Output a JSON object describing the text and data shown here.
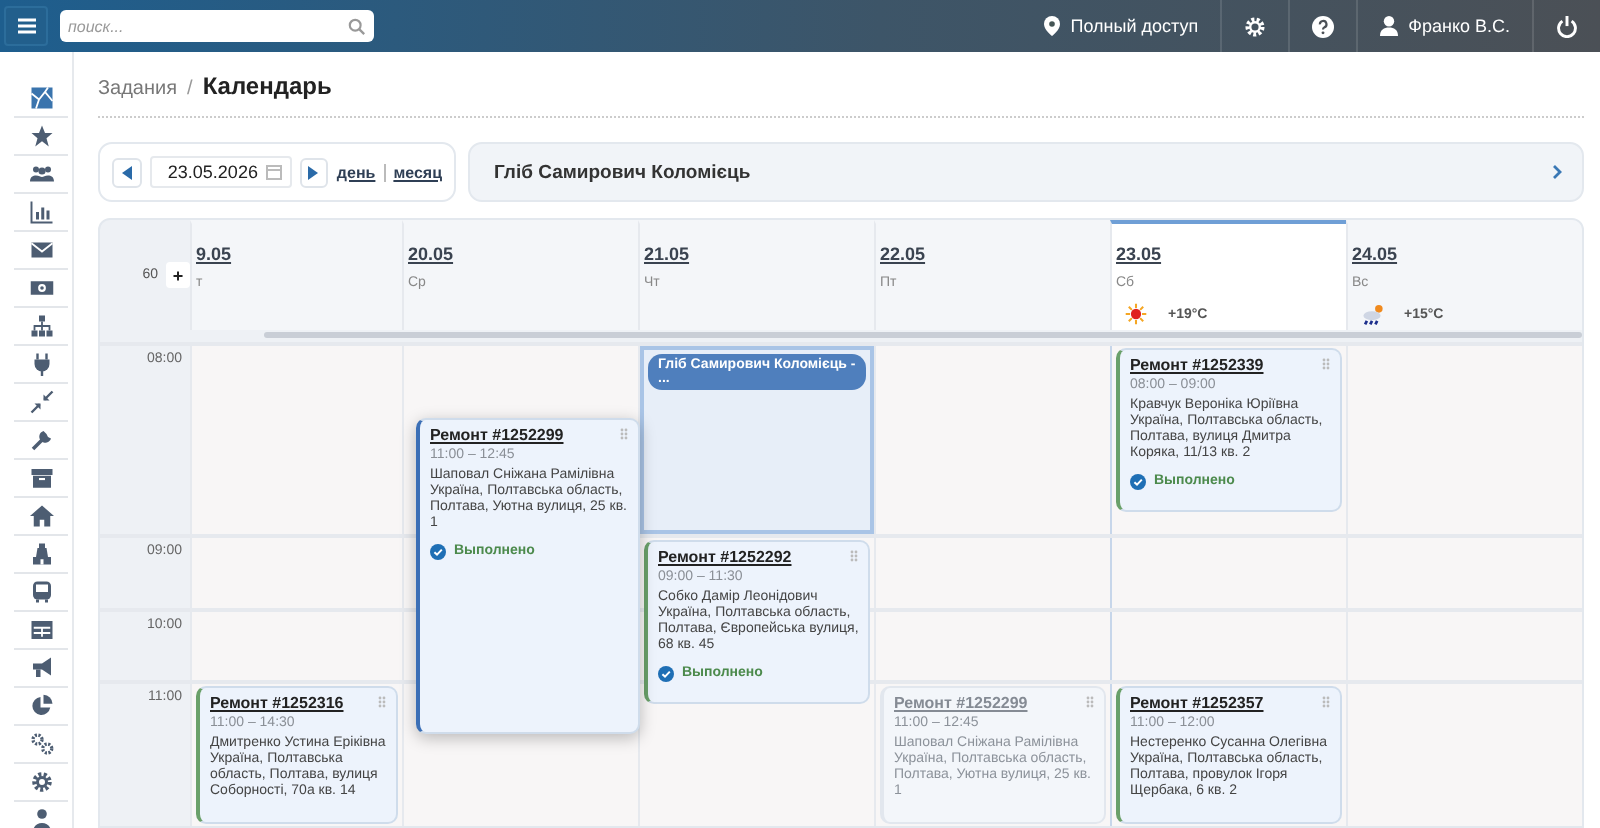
{
  "topbar": {
    "search": {
      "placeholder": "поиск..."
    },
    "access": "Полный доступ",
    "user": "Франко В.С."
  },
  "sidebar": [
    {
      "kind": "map"
    },
    {
      "kind": "star"
    },
    {
      "kind": "users"
    },
    {
      "kind": "chart"
    },
    {
      "kind": "mail"
    },
    {
      "kind": "money"
    },
    {
      "kind": "hierarchy"
    },
    {
      "kind": "plug"
    },
    {
      "kind": "arrows"
    },
    {
      "kind": "wrench"
    },
    {
      "kind": "archive"
    },
    {
      "kind": "home"
    },
    {
      "kind": "tower"
    },
    {
      "kind": "bus"
    },
    {
      "kind": "table"
    },
    {
      "kind": "megaphone"
    },
    {
      "kind": "pie"
    },
    {
      "kind": "gears"
    },
    {
      "kind": "gear"
    },
    {
      "kind": "person"
    }
  ],
  "breadcrumb": {
    "parent": "Задания",
    "separator": "/",
    "current": "Календарь"
  },
  "toolbar": {
    "date": "23.05.2026",
    "views": [
      {
        "label": "день"
      },
      {
        "label": "месяц"
      }
    ],
    "person": "Гліб Самирович Коломієць"
  },
  "calendar": {
    "interval": "60",
    "add_button": "+",
    "days": [
      {
        "date": "9.05",
        "weekday": "т",
        "selected": false
      },
      {
        "date": "20.05",
        "weekday": "Ср",
        "selected": false
      },
      {
        "date": "21.05",
        "weekday": "Чт",
        "selected": false
      },
      {
        "date": "22.05",
        "weekday": "Пт",
        "selected": false
      },
      {
        "date": "23.05",
        "weekday": "Сб",
        "selected": true,
        "weather": {
          "kind": "sun",
          "temp": "+19°C"
        }
      },
      {
        "date": "24.05",
        "weekday": "Вс",
        "selected": false,
        "weather": {
          "kind": "rain",
          "temp": "+15°C"
        }
      }
    ],
    "hours": [
      {
        "time": "08:00",
        "cells": [
          [],
          [
            {
              "kind": "dragging",
              "title": "Ремонт #1252299",
              "time": "11:00 – 12:45",
              "client": "Шаповал Сніжана Рамілівна",
              "address": "Україна, Полтавська область, Полтава, Уютна вулиця, 25 кв. 1",
              "status": "Выполнено"
            }
          ],
          [
            {
              "kind": "person",
              "label": "Гліб Самирович Коломієць - ..."
            }
          ],
          [],
          [
            {
              "kind": "task",
              "title": "Ремонт #1252339",
              "time": "08:00 – 09:00",
              "client": "Кравчук Вероніка Юріївна",
              "address": "Україна, Полтавська область, Полтава, вулиця Дмитра Коряка, 11/13 кв. 2",
              "status": "Выполнено"
            }
          ],
          []
        ]
      },
      {
        "time": "09:00",
        "cells": [
          [],
          [],
          [
            {
              "kind": "task",
              "title": "Ремонт #1252292",
              "time": "09:00 – 11:30",
              "client": "Собко Дамір Леонідович",
              "address": "Україна, Полтавська область, Полтава, Європейська вулиця, 68 кв. 45",
              "status": "Выполнено"
            }
          ],
          [],
          [],
          []
        ]
      },
      {
        "time": "10:00",
        "cells": [
          [],
          [],
          [],
          [],
          [],
          []
        ]
      },
      {
        "time": "11:00",
        "cells": [
          [
            {
              "kind": "task",
              "title": "Ремонт #1252316",
              "time": "11:00 – 14:30",
              "client": "Дмитренко Устина Ерікiвна",
              "address": "Україна, Полтавська область, Полтава, вулиця Соборності, 70а кв. 14"
            }
          ],
          [],
          [],
          [
            {
              "kind": "ghost",
              "title": "Ремонт #1252299",
              "time": "11:00 – 12:45",
              "client": "Шаповал Сніжана Рамілівна",
              "address": "Україна, Полтавська область, Полтава, Уютна вулиця, 25 кв. 1"
            }
          ],
          [
            {
              "kind": "task",
              "title": "Ремонт #1252357",
              "time": "11:00 – 12:00",
              "client": "Нестеренко Сусанна Олегівна",
              "address": "Україна, Полтавська область, Полтава, провулок Ігоря Щербака, 6 кв. 2"
            }
          ],
          []
        ]
      }
    ]
  }
}
